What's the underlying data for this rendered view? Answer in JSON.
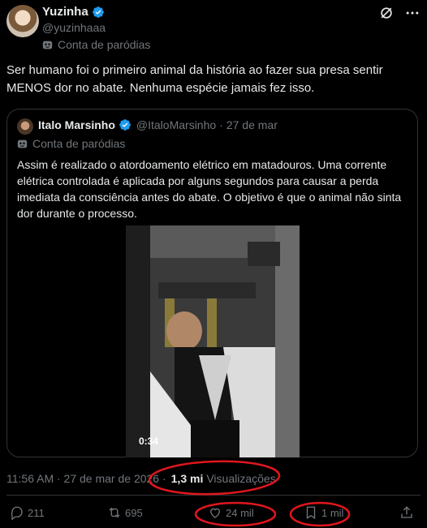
{
  "author": {
    "display_name": "Yuzinha",
    "handle": "@yuzinhaaa",
    "parody_label": "Conta de paródias"
  },
  "tweet": {
    "text": "Ser humano foi o primeiro animal da história ao fazer sua presa sentir MENOS dor no abate. Nenhuma espécie jamais fez isso."
  },
  "quoted": {
    "display_name": "Italo Marsinho",
    "handle": "@ItaloMarsinho",
    "date": "27 de mar",
    "separator": "·",
    "parody_label": "Conta de paródias",
    "text": "Assim é realizado o atordoamento elétrico em matadouros. Uma corrente elétrica controlada é aplicada por alguns segundos para causar a perda imediata da consciência antes do abate. O objetivo é que o animal não sinta dor durante o processo.",
    "video_duration": "0:34"
  },
  "meta": {
    "timestamp": "11:56 AM · 27 de mar de 2026 ·",
    "views_count": "1,3 mi",
    "views_label": "Visualizações"
  },
  "actions": {
    "replies": "211",
    "reposts": "695",
    "likes": "24 mil",
    "bookmarks": "1 mil"
  },
  "colors": {
    "background": "#000000",
    "text": "#e7e9ea",
    "muted": "#71767b",
    "border": "#2f3336",
    "verified": "#1d9bf0",
    "annotation": "#e0161d"
  },
  "icons": [
    "verified-badge-icon",
    "grok-icon",
    "more-icon",
    "mask-icon",
    "reply-icon",
    "repost-icon",
    "like-icon",
    "bookmark-icon",
    "share-icon"
  ]
}
